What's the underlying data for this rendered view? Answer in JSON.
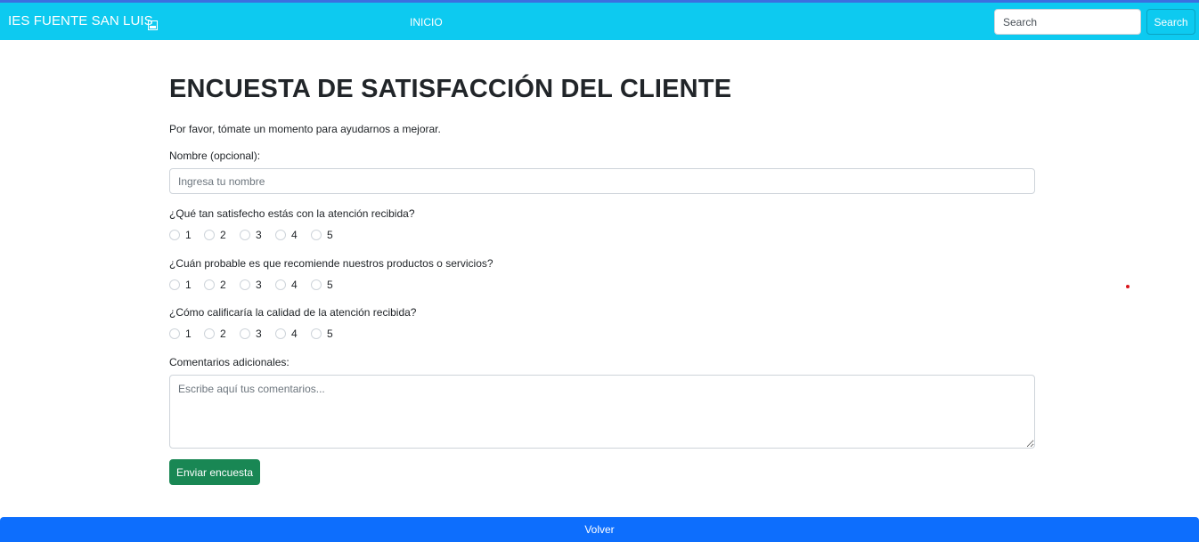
{
  "navbar": {
    "brand": "IES FUENTE SAN LUIS",
    "brand_icon": "window-icon",
    "link": "INICIO",
    "search_placeholder": "Search",
    "search_button": "Search",
    "background": "#0dcaf0"
  },
  "survey": {
    "title": "ENCUESTA DE SATISFACCIÓN DEL CLIENTE",
    "subtitle": "Por favor, tómate un momento para ayudarnos a mejorar.",
    "name_label": "Nombre (opcional):",
    "name_placeholder": "Ingresa tu nombre",
    "questions": [
      {
        "text": "¿Qué tan satisfecho estás con la atención recibida?",
        "options": [
          "1",
          "2",
          "3",
          "4",
          "5"
        ]
      },
      {
        "text": "¿Cuán probable es que recomiende nuestros productos o servicios?",
        "options": [
          "1",
          "2",
          "3",
          "4",
          "5"
        ]
      },
      {
        "text": "¿Cómo calificaría la calidad de la atención recibida?",
        "options": [
          "1",
          "2",
          "3",
          "4",
          "5"
        ]
      }
    ],
    "comments_label": "Comentarios adicionales:",
    "comments_placeholder": "Escribe aquí tus comentarios...",
    "submit_label": "Enviar encuesta",
    "submit_color": "#198754"
  },
  "footer": {
    "back_label": "Volver",
    "back_color": "#0d6efd"
  }
}
